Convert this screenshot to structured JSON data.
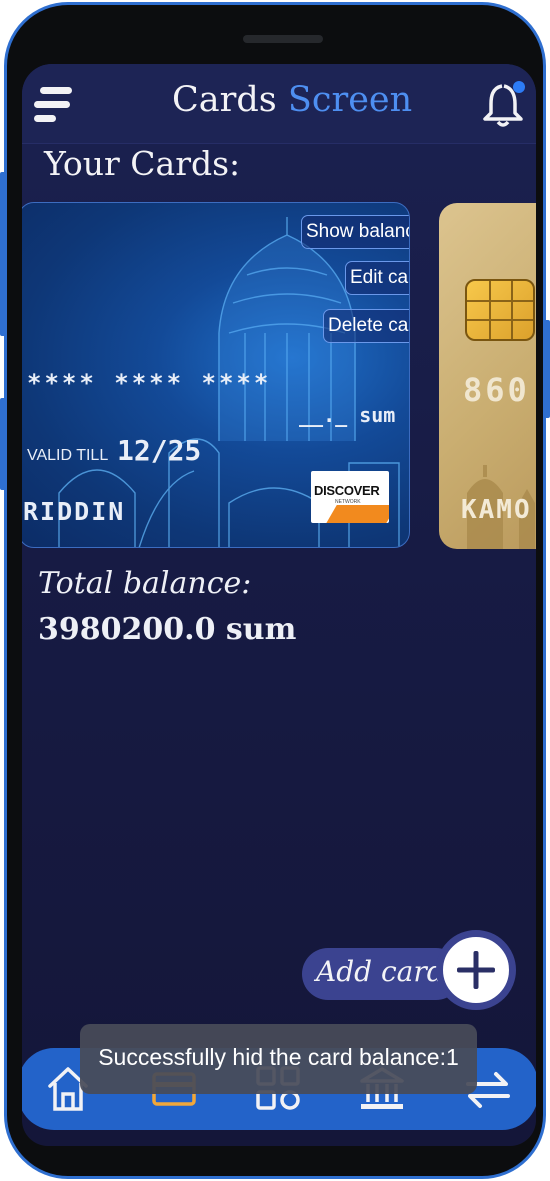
{
  "header": {
    "title_part1": "Cards",
    "title_part2": "Screen",
    "title_accent_color": "#4e8ff1",
    "menu_icon": "hamburger-menu-icon",
    "notification_icon": "bell-icon",
    "notification_dot_color": "#2d7cf6"
  },
  "cards_section": {
    "title": "Your Cards:",
    "cards": [
      {
        "actions": {
          "show_balance": "Show balance",
          "edit": "Edit card",
          "delete": "Delete card"
        },
        "number": "**** **** ****",
        "balance": "__._ sum",
        "valid_label": "VALID TILL",
        "valid_value": "12/25",
        "holder": "RIDDIN",
        "brand": {
          "name": "DISCOVER",
          "sub": "NETWORK"
        }
      },
      {
        "number": "860",
        "holder": "KAMO"
      }
    ]
  },
  "balance": {
    "label": "Total balance:",
    "value": "3980200.0 sum"
  },
  "add_card": {
    "label": "Add card:",
    "icon": "plus-icon"
  },
  "bottom_nav": {
    "items": [
      "home-icon",
      "card-icon",
      "apps-grid-icon",
      "bank-icon",
      "transfer-arrows-icon"
    ],
    "active_index": 1,
    "active_color": "#f1a73a"
  },
  "toast": {
    "text": "Successfully hid the card balance:1"
  }
}
